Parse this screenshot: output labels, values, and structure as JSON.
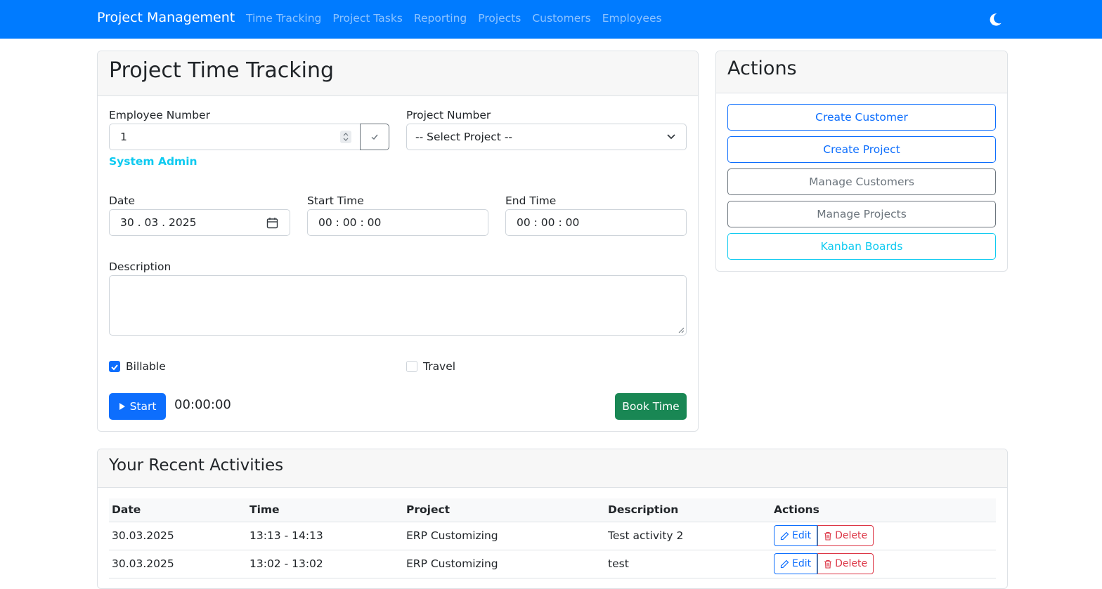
{
  "navbar": {
    "brand": "Project Management",
    "links": [
      "Time Tracking",
      "Project Tasks",
      "Reporting",
      "Projects",
      "Customers",
      "Employees"
    ],
    "theme_icon": "moon-icon"
  },
  "time_tracking": {
    "title": "Project Time Tracking",
    "employee_label": "Employee Number",
    "employee_value": "1",
    "employee_name": "System Admin",
    "project_label": "Project Number",
    "project_value": "-- Select Project --",
    "date_label": "Date",
    "date_value": "30 . 03 . 2025",
    "start_label": "Start Time",
    "start_value": "00 : 00 : 00",
    "end_label": "End Time",
    "end_value": "00 : 00 : 00",
    "description_label": "Description",
    "description_value": "",
    "billable_label": "Billable",
    "billable_checked": true,
    "travel_label": "Travel",
    "travel_checked": false,
    "start_button": "Start",
    "timer": "00:00:00",
    "book_button": "Book Time"
  },
  "actions": {
    "title": "Actions",
    "buttons": [
      "Create Customer",
      "Create Project",
      "Manage Customers",
      "Manage Projects",
      "Kanban Boards"
    ]
  },
  "recent": {
    "title": "Your Recent Activities",
    "columns": [
      "Date",
      "Time",
      "Project",
      "Description",
      "Actions"
    ],
    "rows": [
      {
        "date": "30.03.2025",
        "time": "13:13 - 14:13",
        "project": "ERP Customizing",
        "description": "Test activity 2"
      },
      {
        "date": "30.03.2025",
        "time": "13:02 - 13:02",
        "project": "ERP Customizing",
        "description": "test"
      }
    ],
    "edit_label": "Edit",
    "delete_label": "Delete"
  },
  "colors": {
    "navbar": "#007bff",
    "primary": "#0d6efd",
    "success": "#198754",
    "info": "#0dcaf0",
    "danger": "#dc3545",
    "secondary": "#6c757d"
  }
}
